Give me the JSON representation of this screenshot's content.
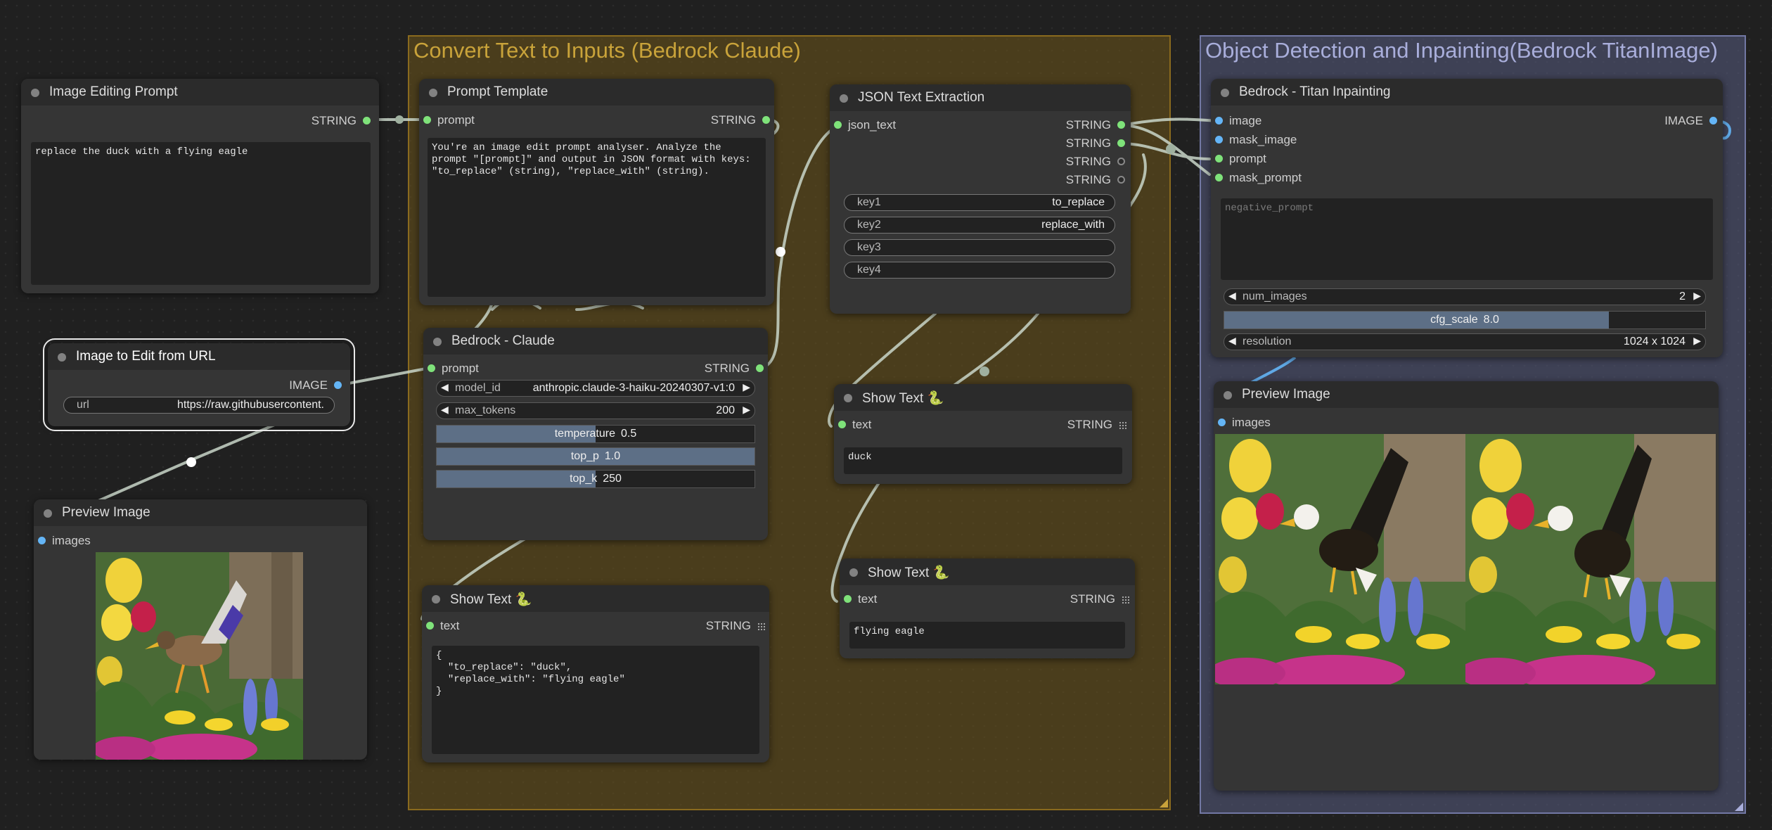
{
  "groups": {
    "convert": {
      "title": "Convert Text to Inputs (Bedrock Claude)"
    },
    "objdet": {
      "title": "Object Detection and Inpainting(Bedrock TitanImage)"
    }
  },
  "nodes": {
    "image_editing_prompt": {
      "title": "Image Editing Prompt",
      "out_type": "STRING",
      "text": "replace the duck with a flying eagle"
    },
    "image_from_url": {
      "title": "Image to Edit from URL",
      "out_type": "IMAGE",
      "url_label": "url",
      "url_value": "https://raw.githubusercontent."
    },
    "preview_left": {
      "title": "Preview Image",
      "in_label": "images"
    },
    "prompt_template": {
      "title": "Prompt Template",
      "in_label": "prompt",
      "out_type": "STRING",
      "text": "You're an image edit prompt analyser. Analyze the prompt \"[prompt]\" and output in JSON format with keys: \"to_replace\" (string), \"replace_with\" (string)."
    },
    "bedrock_claude": {
      "title": "Bedrock - Claude",
      "in_label": "prompt",
      "out_type": "STRING",
      "model_label": "model_id",
      "model_value": "anthropic.claude-3-haiku-20240307-v1:0",
      "max_tokens_label": "max_tokens",
      "max_tokens_value": "200",
      "temperature_label": "temperature",
      "temperature_value": "0.5",
      "temperature_fraction": 0.5,
      "top_p_label": "top_p",
      "top_p_value": "1.0",
      "top_p_fraction": 1.0,
      "top_k_label": "top_k",
      "top_k_value": "250",
      "top_k_fraction": 0.5
    },
    "show_text_json": {
      "title": "Show Text 🐍",
      "in_label": "text",
      "out_type": "STRING",
      "text": "{\n  \"to_replace\": \"duck\",\n  \"replace_with\": \"flying eagle\"\n}"
    },
    "json_extract": {
      "title": "JSON Text Extraction",
      "in_label": "json_text",
      "out_types": [
        "STRING",
        "STRING",
        "STRING",
        "STRING"
      ],
      "keys": [
        {
          "label": "key1",
          "value": "to_replace"
        },
        {
          "label": "key2",
          "value": "replace_with"
        },
        {
          "label": "key3",
          "value": ""
        },
        {
          "label": "key4",
          "value": ""
        }
      ]
    },
    "show_text_duck": {
      "title": "Show Text 🐍",
      "in_label": "text",
      "out_type": "STRING",
      "text": "duck"
    },
    "show_text_eagle": {
      "title": "Show Text 🐍",
      "in_label": "text",
      "out_type": "STRING",
      "text": "flying eagle"
    },
    "titan_inpaint": {
      "title": "Bedrock - Titan Inpainting",
      "inputs": [
        "image",
        "mask_image",
        "prompt",
        "mask_prompt"
      ],
      "out_type": "IMAGE",
      "negative_placeholder": "negative_prompt",
      "num_images_label": "num_images",
      "num_images_value": "2",
      "cfg_label": "cfg_scale",
      "cfg_value": "8.0",
      "cfg_fraction": 0.8,
      "resolution_label": "resolution",
      "resolution_value": "1024 x 1024"
    },
    "preview_right": {
      "title": "Preview Image",
      "in_label": "images"
    }
  },
  "colors": {
    "string_port": "#7fe27a",
    "image_port": "#64b5f6",
    "link": "#c9d6c9",
    "convert_group": "#c9a33a",
    "objdet_group": "#a9aedb"
  }
}
